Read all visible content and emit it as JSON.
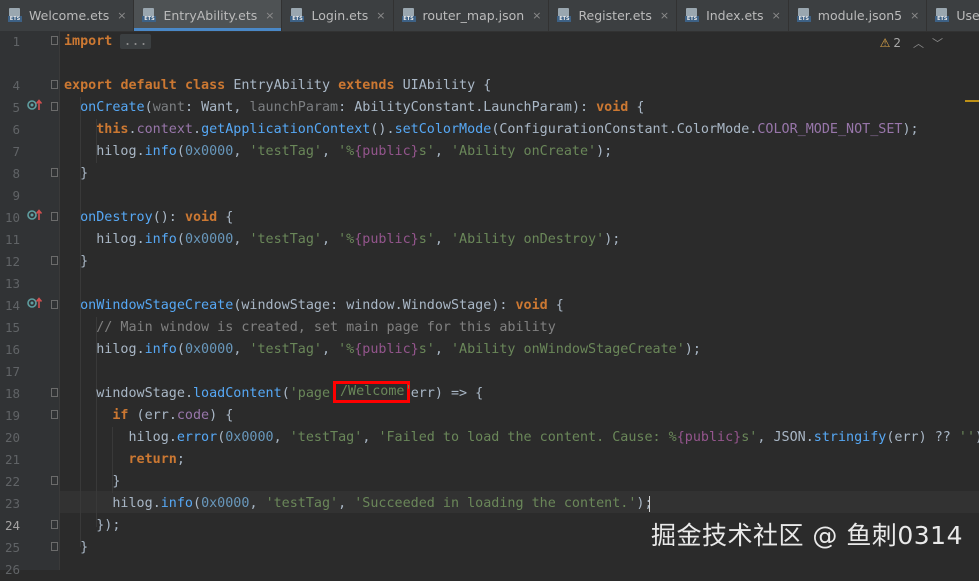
{
  "tabs": [
    {
      "label": "Welcome.ets",
      "icon": "ets-file-icon",
      "active": false
    },
    {
      "label": "EntryAbility.ets",
      "icon": "ets-file-icon",
      "active": true
    },
    {
      "label": "Login.ets",
      "icon": "ets-file-icon",
      "active": false
    },
    {
      "label": "router_map.json",
      "icon": "json-file-icon",
      "active": false
    },
    {
      "label": "Register.ets",
      "icon": "ets-file-icon",
      "active": false
    },
    {
      "label": "Index.ets",
      "icon": "ets-file-icon",
      "active": false
    },
    {
      "label": "module.json5",
      "icon": "json5-file-icon",
      "active": false
    },
    {
      "label": "UserIn",
      "icon": "ets-file-icon",
      "active": false
    }
  ],
  "tab_icon_label": "ETS",
  "tab_close_glyph": "×",
  "warnings": {
    "count": "2",
    "icon": "warning-triangle-icon"
  },
  "gutter": {
    "line_numbers": [
      "1",
      "4",
      "5",
      "6",
      "7",
      "8",
      "9",
      "10",
      "11",
      "12",
      "13",
      "14",
      "15",
      "16",
      "17",
      "18",
      "19",
      "20",
      "21",
      "22",
      "23",
      "24",
      "25",
      "26"
    ],
    "current_line": "24"
  },
  "code": {
    "line1_import": "import",
    "line1_folded": "...",
    "export": "export",
    "default": "default",
    "class": "class",
    "class_name": "EntryAbility",
    "extends": "extends",
    "parent_class": "UIAbility",
    "onCreate": "onCreate",
    "want": "want",
    "want_type": "Want",
    "launchParam": "launchParam",
    "ability_constant": "AbilityConstant",
    "launch_param_type": "LaunchParam",
    "void": "void",
    "this": "this",
    "context": "context",
    "getApplicationContext": "getApplicationContext",
    "setColorMode": "setColorMode",
    "config_constant": "ConfigurationConstant",
    "color_mode": "ColorMode",
    "color_mode_value": "COLOR_MODE_NOT_SET",
    "hilog": "hilog",
    "info": "info",
    "error": "error",
    "domain": "0x0000",
    "test_tag": "'testTag'",
    "fmt_open": "'%",
    "fmt_public": "{public}",
    "fmt_close": "s'",
    "msg_onCreate": "'Ability onCreate'",
    "onDestroy": "onDestroy",
    "msg_onDestroy": "'Ability onDestroy'",
    "onWindowStageCreate": "onWindowStageCreate",
    "windowStage": "windowStage",
    "window_ns": "window",
    "window_stage_type": "WindowStage",
    "comment_main_window": "// Main window is created, set main page for this ability",
    "msg_onWindowStageCreate": "'Ability onWindowStageCreate'",
    "loadContent": "loadContent",
    "page_prefix": "'page",
    "page_highlight": "/Welcome'",
    "err": "err",
    "if": "if",
    "code_prop": "code",
    "msg_failed_pre": "'Failed to load the content. Cause: %",
    "JSON": "JSON",
    "stringify": "stringify",
    "empty_str": "''",
    "return": "return",
    "msg_success": "'Succeeded in loading the content.'"
  },
  "watermark": "掘金技术社区 @ 鱼刺0314"
}
